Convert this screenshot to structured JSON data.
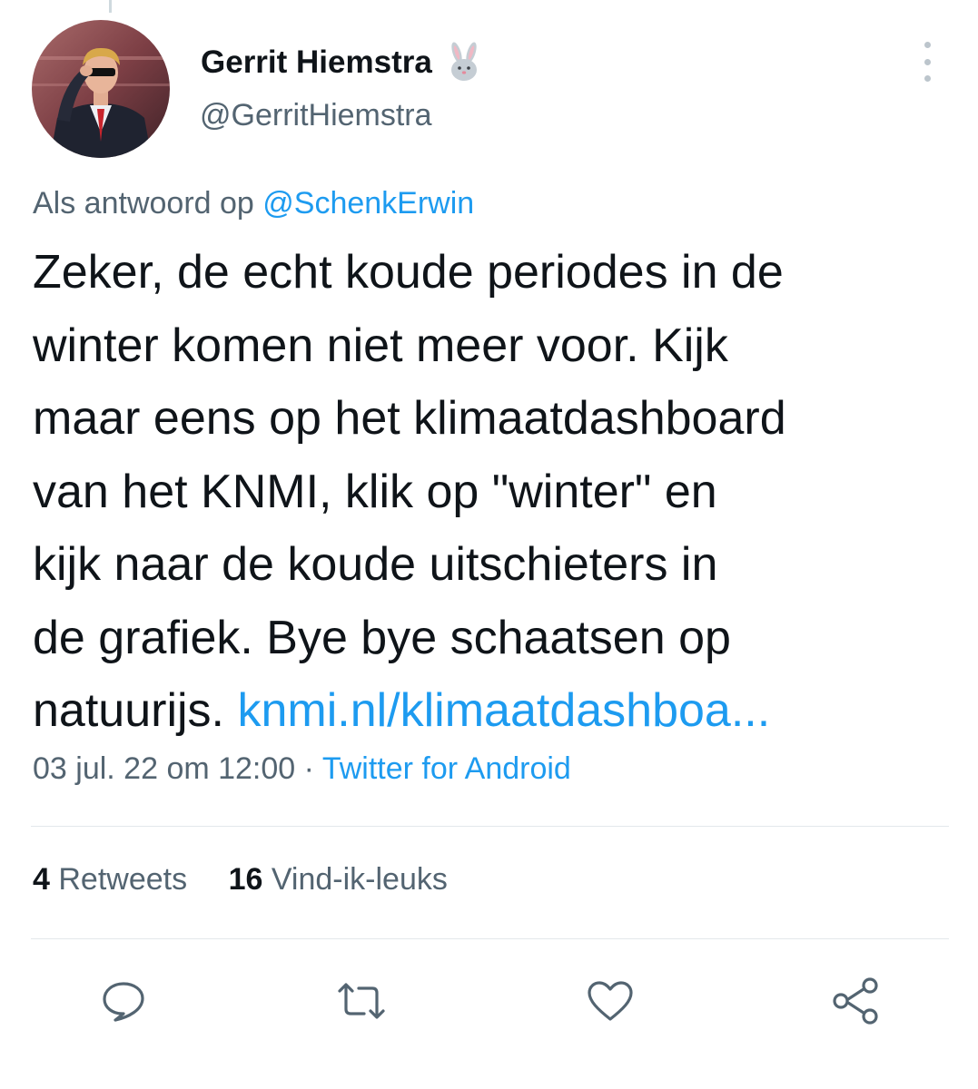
{
  "author": {
    "display_name": "Gerrit Hiemstra",
    "handle": "@GerritHiemstra",
    "badge_icon": "rabbit-emoji-icon"
  },
  "reply_context": {
    "prefix": "Als antwoord op",
    "mention": "@SchenkErwin"
  },
  "tweet": {
    "lines": [
      "Zeker, de echt koude periodes in de",
      "winter komen niet meer voor. Kijk",
      "maar eens op het klimaatdashboard",
      "van het KNMI, klik op \"winter\" en",
      "kijk naar de koude uitschieters in",
      "de grafiek. Bye bye schaatsen op",
      "natuurijs."
    ],
    "link_text": "knmi.nl/klimaatdashboa..."
  },
  "meta": {
    "timestamp": "03 jul. 22 om 12:00",
    "separator": "·",
    "source": "Twitter for Android"
  },
  "stats": {
    "retweets_count": "4",
    "retweets_label": "Retweets",
    "likes_count": "16",
    "likes_label": "Vind-ik-leuks"
  },
  "actions": {
    "reply_icon": "comment-icon",
    "retweet_icon": "retweet-icon",
    "like_icon": "heart-icon",
    "share_icon": "share-icon"
  },
  "colors": {
    "link": "#1d9bf0",
    "text": "#0f1419",
    "secondary": "#536471",
    "icon": "#536471"
  }
}
